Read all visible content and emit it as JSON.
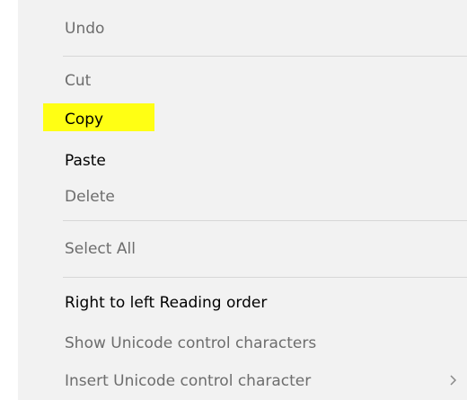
{
  "context_menu": {
    "items": [
      {
        "label": "Undo",
        "enabled": false
      },
      {
        "label": "Cut",
        "enabled": false
      },
      {
        "label": "Copy",
        "enabled": true,
        "highlighted": true
      },
      {
        "label": "Paste",
        "enabled": true
      },
      {
        "label": "Delete",
        "enabled": false
      },
      {
        "label": "Select All",
        "enabled": false
      },
      {
        "label": "Right to left Reading order",
        "enabled": true
      },
      {
        "label": "Show Unicode control characters",
        "enabled": false
      },
      {
        "label": "Insert Unicode control character",
        "enabled": false,
        "has_submenu": true
      }
    ],
    "highlight_color": "#ffff14",
    "background_color": "#f2f2f2",
    "disabled_text_color": "#6d6d6d",
    "submenu_arrow_icon": "chevron-right-icon"
  }
}
